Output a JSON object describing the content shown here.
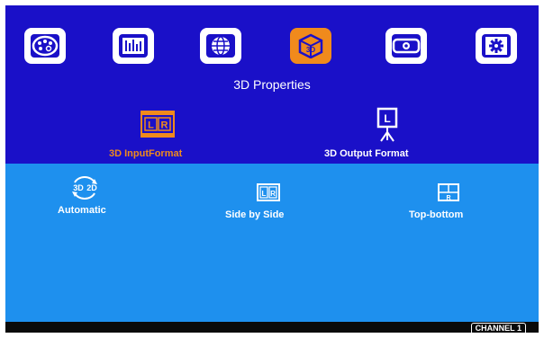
{
  "menu": {
    "tabs": [
      {
        "icon": "palette-icon"
      },
      {
        "icon": "equalizer-icon"
      },
      {
        "icon": "globe-icon"
      },
      {
        "icon": "cube-3d-icon",
        "label": "3D",
        "active": true
      },
      {
        "icon": "projector-icon"
      },
      {
        "icon": "gear-icon"
      }
    ]
  },
  "page_title": "3D Properties",
  "submenu": {
    "input_format": {
      "label": "3D InputFormat",
      "icon_text": "L R",
      "color": "#f08a1c",
      "active": true
    },
    "output_format": {
      "label": "3D Output Format",
      "icon_text": "L",
      "color": "#ffffff"
    }
  },
  "options": [
    {
      "label": "Automatic",
      "icon_text": "3D 2D"
    },
    {
      "label": "Side by Side",
      "icon_text": "L R"
    },
    {
      "label": "Top-bottom",
      "icon_text": "R"
    }
  ],
  "status": {
    "channel": "CHANNEL 1"
  },
  "colors": {
    "top_bg": "#1a10c8",
    "bottom_bg": "#1e90ee",
    "accent": "#f08a1c"
  }
}
